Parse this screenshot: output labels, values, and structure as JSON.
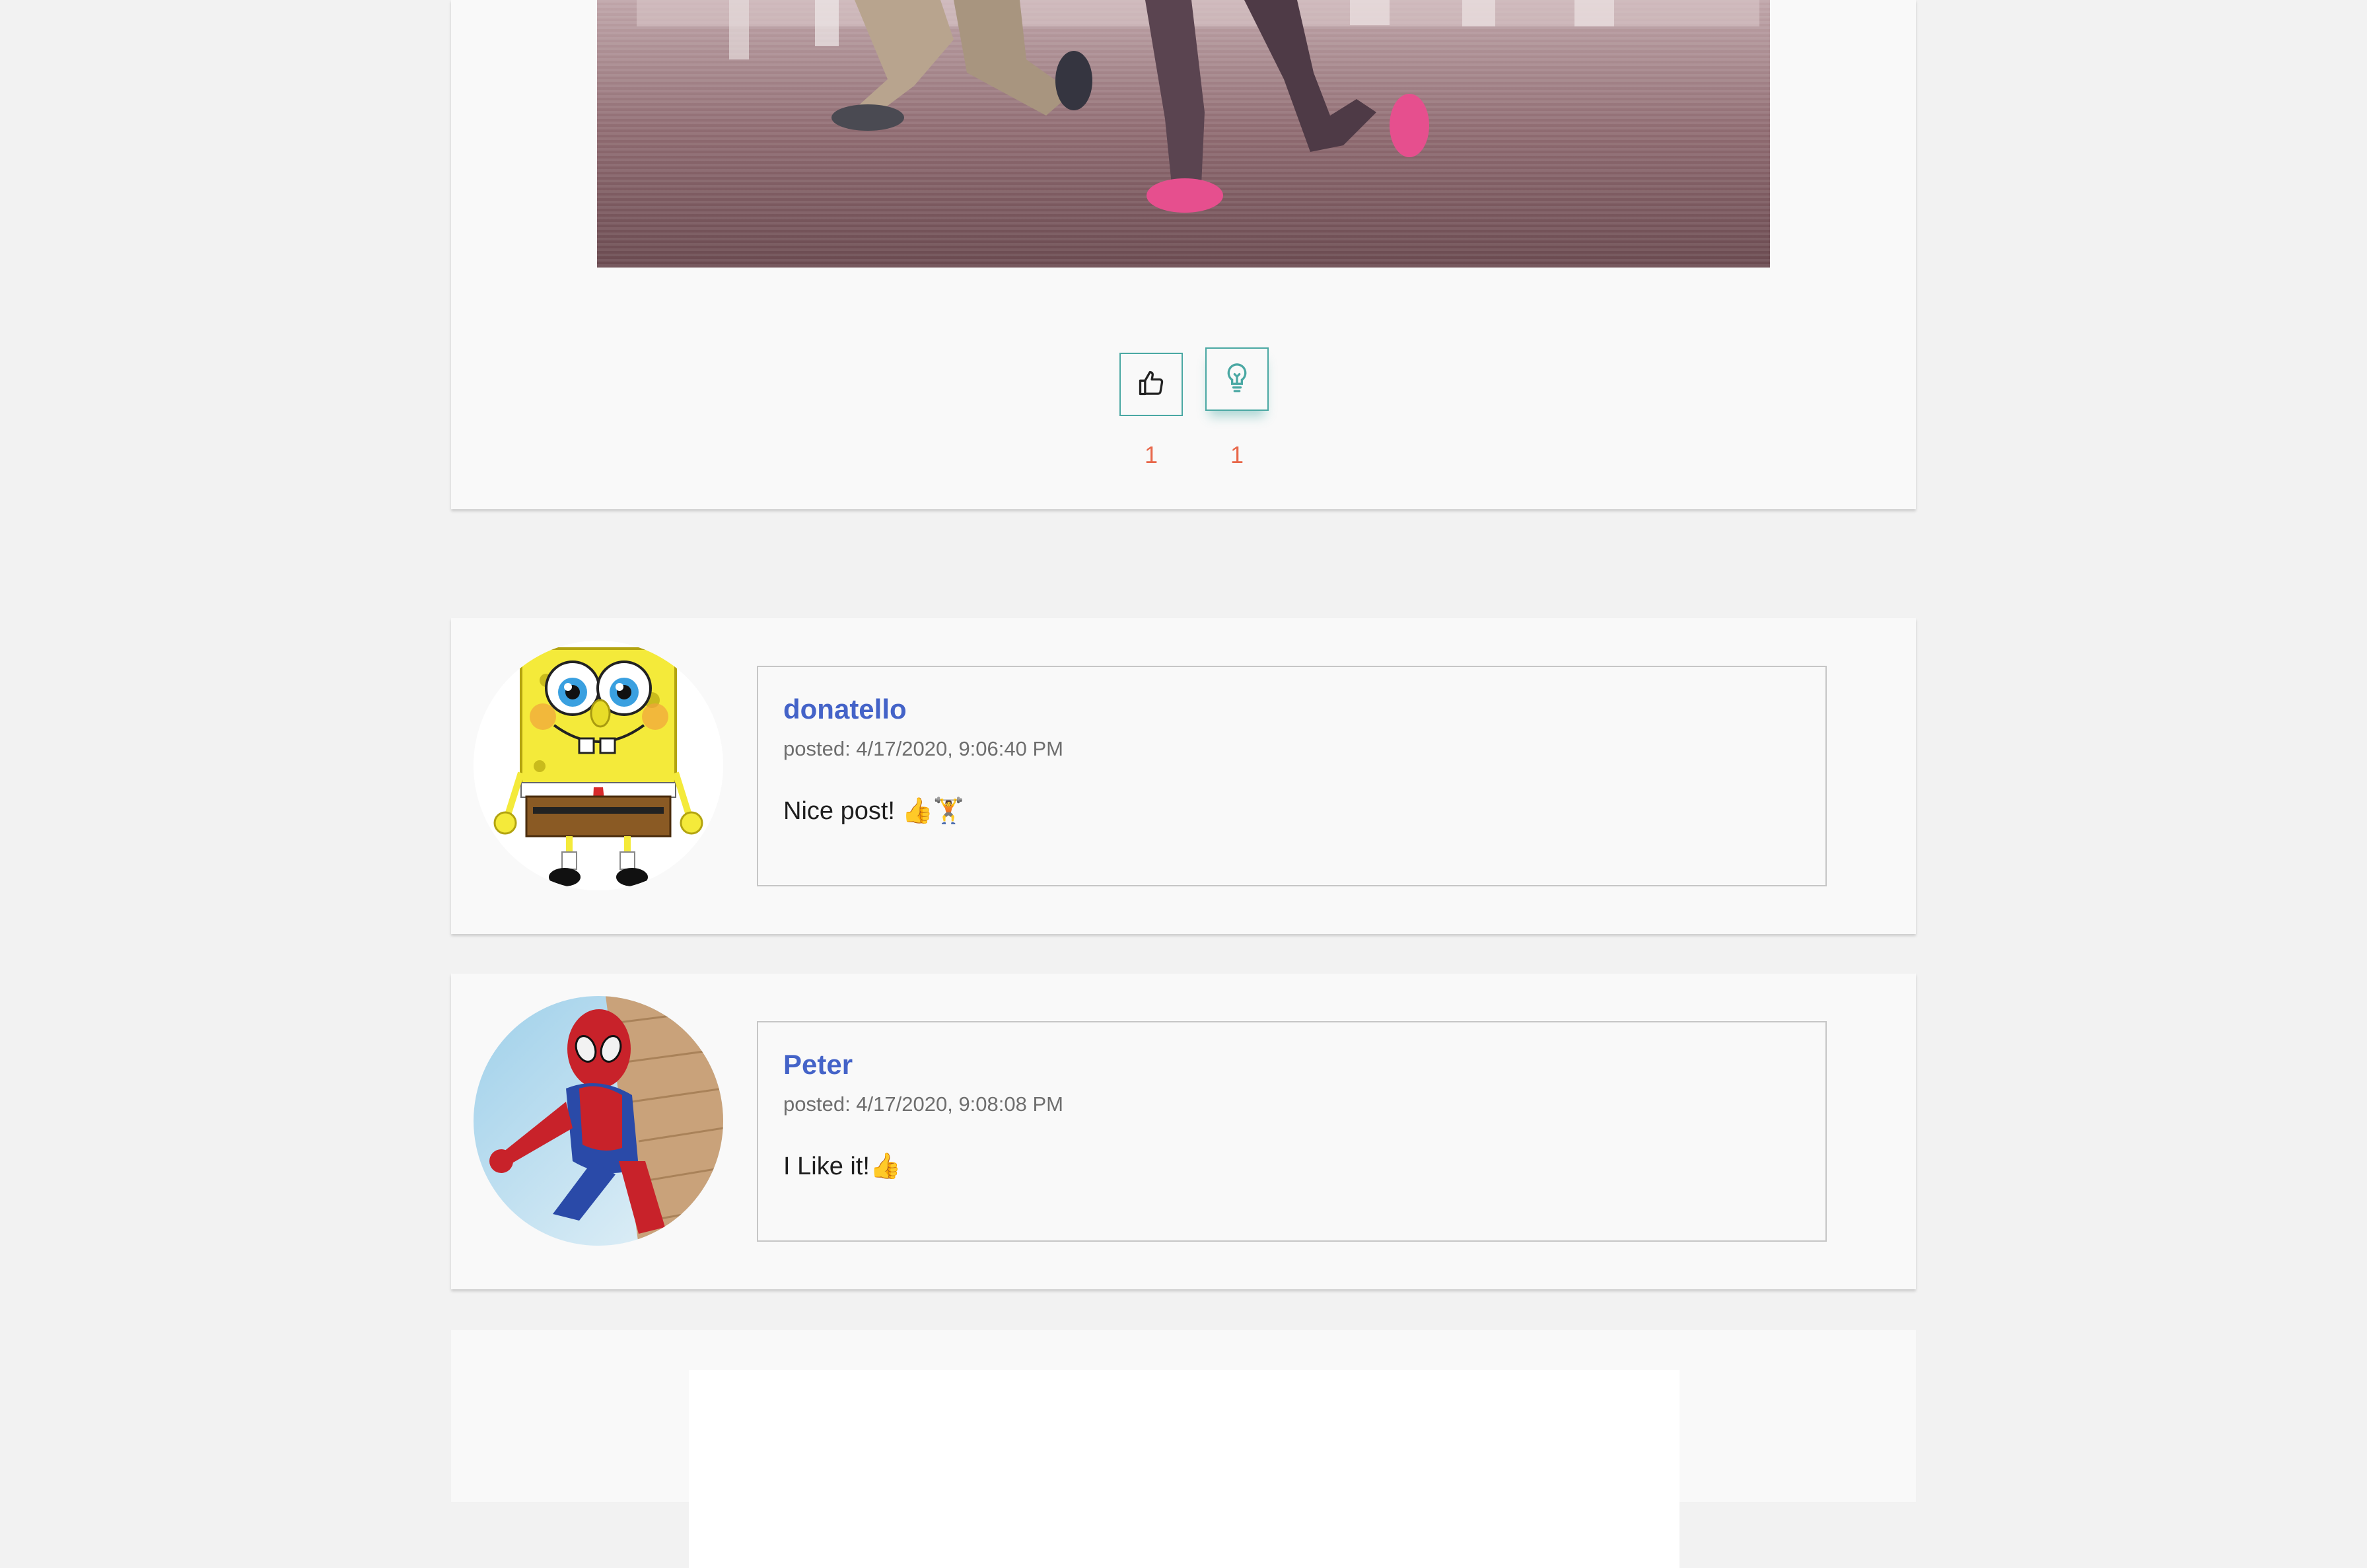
{
  "post": {
    "image_alt": "Two people doing lunges in a gym",
    "reactions": {
      "like_icon": "thumbs-up-icon",
      "like_count": "1",
      "idea_icon": "lightbulb-icon",
      "idea_count": "1"
    }
  },
  "comments": [
    {
      "author": "donatello",
      "date": "posted: 4/17/2020, 9:06:40 PM",
      "text": "Nice post! 👍🏋",
      "avatar": "spongebob-avatar"
    },
    {
      "author": "Peter",
      "date": "posted: 4/17/2020, 9:08:08 PM",
      "text": "I Like it!👍",
      "avatar": "spiderman-avatar"
    }
  ],
  "colors": {
    "accent": "#4aa8a3",
    "author": "#4463c8",
    "count": "#e8674a"
  }
}
